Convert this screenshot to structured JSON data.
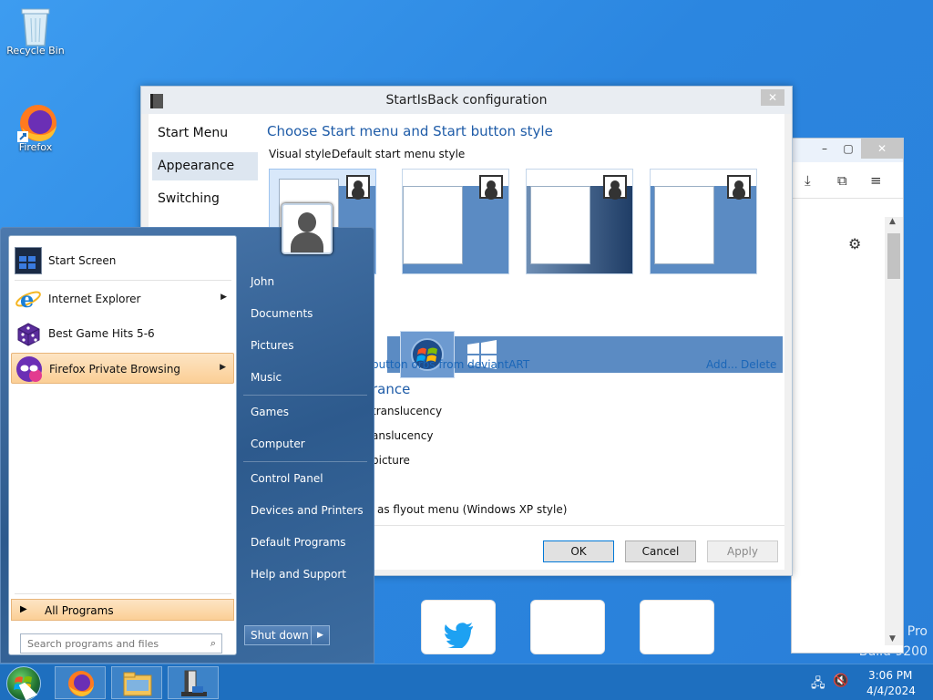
{
  "desktop": {
    "icons": [
      {
        "label": "Recycle Bin"
      },
      {
        "label": "Firefox"
      }
    ],
    "watermark_pro": "Pro",
    "watermark_build": "Build 9200"
  },
  "config": {
    "title": "StartIsBack configuration",
    "nav": [
      "Start Menu",
      "Appearance",
      "Switching"
    ],
    "heading": "Choose Start menu and Start button style",
    "visual_style_label": "Visual style:",
    "visual_style_value": "Default start menu style",
    "orbs_link": "button orbs from deviantART",
    "add_link": "Add...",
    "delete_link": "Delete",
    "appearance_heading": "rance",
    "options": [
      "translucency",
      "anslucency",
      "picture",
      "as flyout menu (Windows XP style)"
    ],
    "ok": "OK",
    "cancel": "Cancel",
    "apply": "Apply"
  },
  "startmenu": {
    "pinned": [
      {
        "label": "Start Screen"
      },
      {
        "label": "Internet Explorer"
      },
      {
        "label": "Best Game Hits 5-6"
      },
      {
        "label": "Firefox Private Browsing"
      }
    ],
    "all_programs": "All Programs",
    "search_placeholder": "Search programs and files",
    "right": [
      "John",
      "Documents",
      "Pictures",
      "Music",
      "Games",
      "Computer",
      "Control Panel",
      "Devices and Printers",
      "Default Programs",
      "Help and Support"
    ],
    "shutdown": "Shut down"
  },
  "taskbar": {
    "time": "3:06 PM",
    "date": "4/4/2024"
  },
  "colors": {
    "desktop": "#2b86e0",
    "taskbar": "#1e6fbf",
    "link": "#1a66b8",
    "hover": "#fbcf96"
  }
}
